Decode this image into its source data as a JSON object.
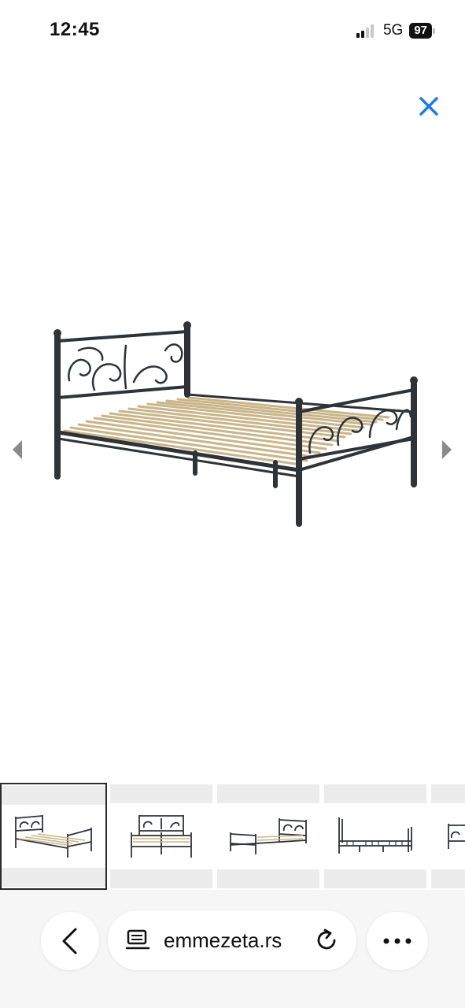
{
  "status_bar": {
    "time": "12:45",
    "network": "5G",
    "battery": "97"
  },
  "viewer": {
    "close_icon": "close-icon",
    "prev_icon": "triangle-left-icon",
    "next_icon": "triangle-right-icon",
    "accent_color": "#1a7ee0"
  },
  "thumbnails": {
    "selected_index": 0,
    "count_visible": 5
  },
  "browser_bar": {
    "back_icon": "chevron-left-icon",
    "reader_icon": "reader-mode-icon",
    "url": "emmezeta.rs",
    "reload_icon": "reload-icon",
    "more_icon": "more-dots-icon"
  }
}
